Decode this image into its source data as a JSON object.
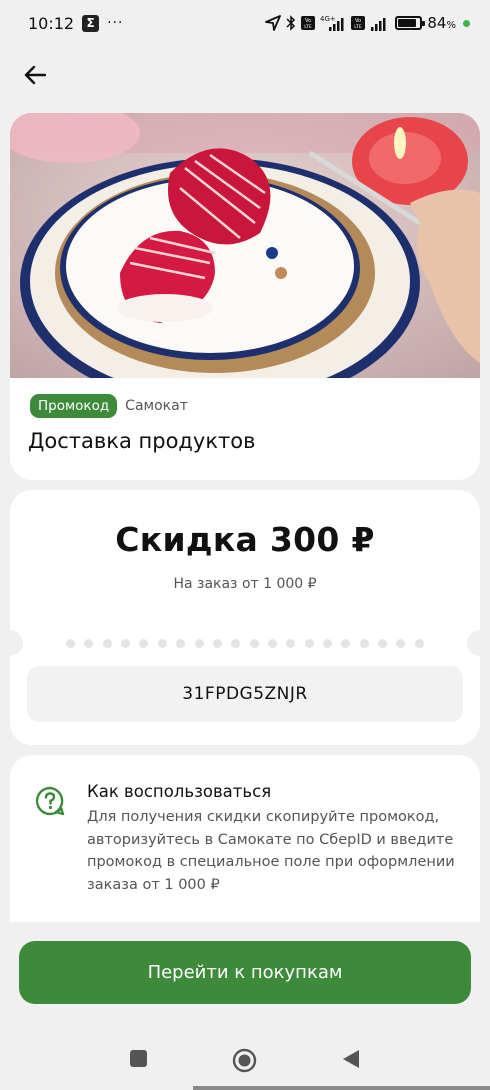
{
  "status_bar": {
    "time": "10:12",
    "dots": "···",
    "battery": "84",
    "battery_unit": "%",
    "battery_level": 0.84,
    "network": "4G+"
  },
  "nav": {
    "back_icon": "arrow-left-icon"
  },
  "offer": {
    "tag": "Промокод",
    "brand": "Самокат",
    "title": "Доставка продуктов"
  },
  "discount": {
    "title": "Скидка 300 ₽",
    "subtitle": "На заказ от 1 000 ₽",
    "promo_code": "31FPDG5ZNJR"
  },
  "how_to": {
    "icon": "question-bubble-icon",
    "title": "Как воспользоваться",
    "text": "Для получения скидки скопируйте промокод, авторизуйтесь в Самокате по СберID и введите промокод в специальное поле при оформлении заказа от 1 000 ₽"
  },
  "cta": {
    "label": "Перейти к покупкам"
  },
  "colors": {
    "accent": "#3c8a3a",
    "background": "#f0f0f0",
    "card": "#ffffff"
  }
}
